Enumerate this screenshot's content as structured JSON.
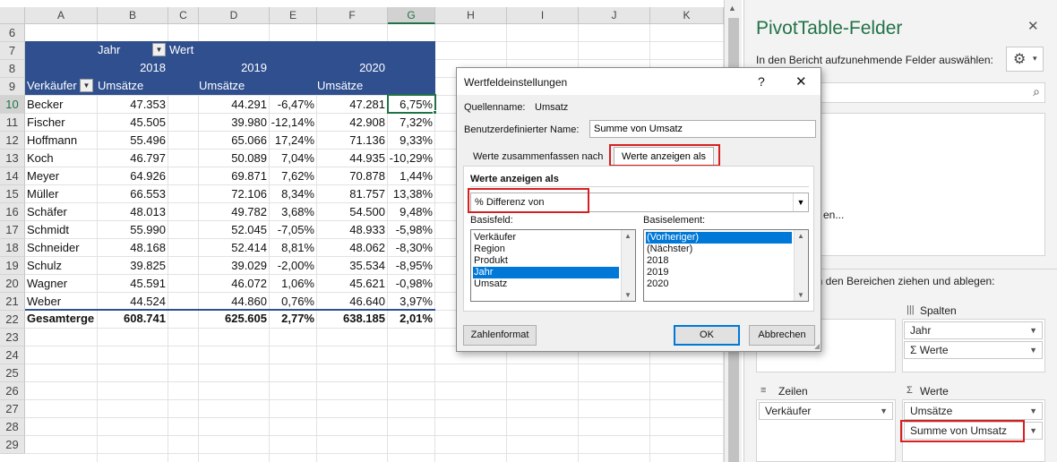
{
  "spreadsheet": {
    "columns": [
      "A",
      "B",
      "C",
      "D",
      "E",
      "F",
      "G",
      "H",
      "I",
      "J",
      "K"
    ],
    "selected_column": "G",
    "rows_top": [
      "6",
      "7",
      "8",
      "9"
    ],
    "data_rows": [
      {
        "row": "10",
        "seller": "Becker",
        "v2018": "47.353",
        "v2019": "44.291",
        "p2019": "-6,47%",
        "v2020": "47.281",
        "p2020": "6,75%"
      },
      {
        "row": "11",
        "seller": "Fischer",
        "v2018": "45.505",
        "v2019": "39.980",
        "p2019": "-12,14%",
        "v2020": "42.908",
        "p2020": "7,32%"
      },
      {
        "row": "12",
        "seller": "Hoffmann",
        "v2018": "55.496",
        "v2019": "65.066",
        "p2019": "17,24%",
        "v2020": "71.136",
        "p2020": "9,33%"
      },
      {
        "row": "13",
        "seller": "Koch",
        "v2018": "46.797",
        "v2019": "50.089",
        "p2019": "7,04%",
        "v2020": "44.935",
        "p2020": "-10,29%"
      },
      {
        "row": "14",
        "seller": "Meyer",
        "v2018": "64.926",
        "v2019": "69.871",
        "p2019": "7,62%",
        "v2020": "70.878",
        "p2020": "1,44%"
      },
      {
        "row": "15",
        "seller": "Müller",
        "v2018": "66.553",
        "v2019": "72.106",
        "p2019": "8,34%",
        "v2020": "81.757",
        "p2020": "13,38%"
      },
      {
        "row": "16",
        "seller": "Schäfer",
        "v2018": "48.013",
        "v2019": "49.782",
        "p2019": "3,68%",
        "v2020": "54.500",
        "p2020": "9,48%"
      },
      {
        "row": "17",
        "seller": "Schmidt",
        "v2018": "55.990",
        "v2019": "52.045",
        "p2019": "-7,05%",
        "v2020": "48.933",
        "p2020": "-5,98%"
      },
      {
        "row": "18",
        "seller": "Schneider",
        "v2018": "48.168",
        "v2019": "52.414",
        "p2019": "8,81%",
        "v2020": "48.062",
        "p2020": "-8,30%"
      },
      {
        "row": "19",
        "seller": "Schulz",
        "v2018": "39.825",
        "v2019": "39.029",
        "p2019": "-2,00%",
        "v2020": "35.534",
        "p2020": "-8,95%"
      },
      {
        "row": "20",
        "seller": "Wagner",
        "v2018": "45.591",
        "v2019": "46.072",
        "p2019": "1,06%",
        "v2020": "45.621",
        "p2020": "-0,98%"
      },
      {
        "row": "21",
        "seller": "Weber",
        "v2018": "44.524",
        "v2019": "44.860",
        "p2019": "0,76%",
        "v2020": "46.640",
        "p2020": "3,97%"
      }
    ],
    "total": {
      "row": "22",
      "label": "Gesamterge",
      "v2018": "608.741",
      "v2019": "625.605",
      "p2019": "2,77%",
      "v2020": "638.185",
      "p2020": "2,01%"
    },
    "rows_bottom": [
      "23",
      "24",
      "25",
      "26",
      "27",
      "28",
      "29"
    ],
    "pivot": {
      "jahr_label": "Jahr",
      "wert_label": "Wert",
      "year_2018": "2018",
      "year_2019": "2019",
      "year_2020": "2020",
      "seller_header": "Verkäufer",
      "umsaetze": "Umsätze"
    }
  },
  "dialog": {
    "title": "Wertfeldeinstellungen",
    "help": "?",
    "close": "✕",
    "source_label": "Quellenname:",
    "source_value": "Umsatz",
    "custom_name_label": "Benutzerdefinierter Name:",
    "custom_name_value": "Summe von Umsatz",
    "tab_summarize": "Werte zusammenfassen nach",
    "tab_show_as": "Werte anzeigen als",
    "section_title": "Werte anzeigen als",
    "show_as_value": "% Differenz von",
    "base_field_label": "Basisfeld:",
    "base_field_items": [
      "Verkäufer",
      "Region",
      "Produkt",
      "Jahr",
      "Umsatz"
    ],
    "base_field_selected": 3,
    "base_item_label": "Basiselement:",
    "base_item_items": [
      "(Vorheriger)",
      "(Nächster)",
      "2018",
      "2019",
      "2020"
    ],
    "base_item_selected": 0,
    "number_format_btn": "Zahlenformat",
    "ok_btn": "OK",
    "cancel_btn": "Abbrechen",
    "accent_red": "#d62020",
    "selection_blue": "#0078d7"
  },
  "pivot_pane": {
    "title": "PivotTable-Felder",
    "close": "✕",
    "dropdown_arrow": "▾",
    "choose_fields": "In den Bericht aufzunehmende Felder auswählen:",
    "fields_partial": "en...",
    "drag_text": "en den Bereichen ziehen und ablegen:",
    "columns_label": "Spalten",
    "columns_items": [
      "Jahr",
      "Werte"
    ],
    "values_sigma": "Σ",
    "rows_label": "Zeilen",
    "rows_items": [
      "Verkäufer"
    ],
    "values_label": "Werte",
    "values_items": [
      "Umsätze",
      "Summe von Umsatz"
    ],
    "header_blue": "#2f4f8f",
    "green": "#217346"
  }
}
